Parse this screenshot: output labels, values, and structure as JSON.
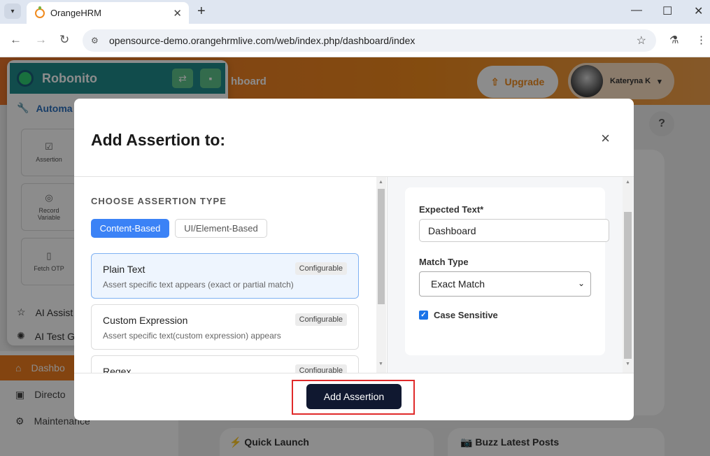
{
  "browser": {
    "tab_title": "OrangeHRM",
    "tab_close": "✕",
    "new_tab": "+",
    "url": "opensource-demo.orangehrmlive.com/web/index.php/dashboard/index"
  },
  "app": {
    "header_title": "hboard",
    "upgrade_label": "Upgrade",
    "user_name": "Kateryna K",
    "help_label": "?",
    "nav": [
      {
        "label": "Dashbo"
      },
      {
        "label": "Directo"
      },
      {
        "label": "Maintenance"
      }
    ],
    "cards": {
      "quick_launch": "Quick Launch",
      "buzz_posts": "Buzz Latest Posts"
    }
  },
  "robonito": {
    "name": "Robonito",
    "section": "Automa",
    "tiles": [
      {
        "label": "Assertion"
      },
      {
        "label": "Record\nVariable"
      },
      {
        "label": "Fetch OTP"
      }
    ],
    "items": [
      {
        "label": "AI Assist"
      },
      {
        "label": "AI Test G"
      }
    ]
  },
  "modal": {
    "title": "Add Assertion to:",
    "close_label": "×",
    "section_label": "CHOOSE ASSERTION TYPE",
    "tabs": [
      {
        "label": "Content-Based",
        "active": true
      },
      {
        "label": "UI/Element-Based",
        "active": false
      }
    ],
    "assertion_types": [
      {
        "name": "Plain Text",
        "desc": "Assert specific text appears (exact or partial match)",
        "badge": "Configurable",
        "selected": true
      },
      {
        "name": "Custom Expression",
        "desc": "Assert specific text(custom expression) appears",
        "badge": "Configurable",
        "selected": false
      },
      {
        "name": "Regex",
        "desc": "",
        "badge": "Configurable",
        "selected": false
      }
    ],
    "config": {
      "expected_text_label": "Expected Text*",
      "expected_text_value": "Dashboard",
      "match_type_label": "Match Type",
      "match_type_value": "Exact Match",
      "case_sensitive_label": "Case Sensitive",
      "case_sensitive_checked": true
    },
    "submit_label": "Add Assertion"
  },
  "colors": {
    "accent_orange": "#f08a1d",
    "primary_blue": "#3b82f6",
    "button_dark": "#101830",
    "highlight_red": "#e02a2a"
  }
}
